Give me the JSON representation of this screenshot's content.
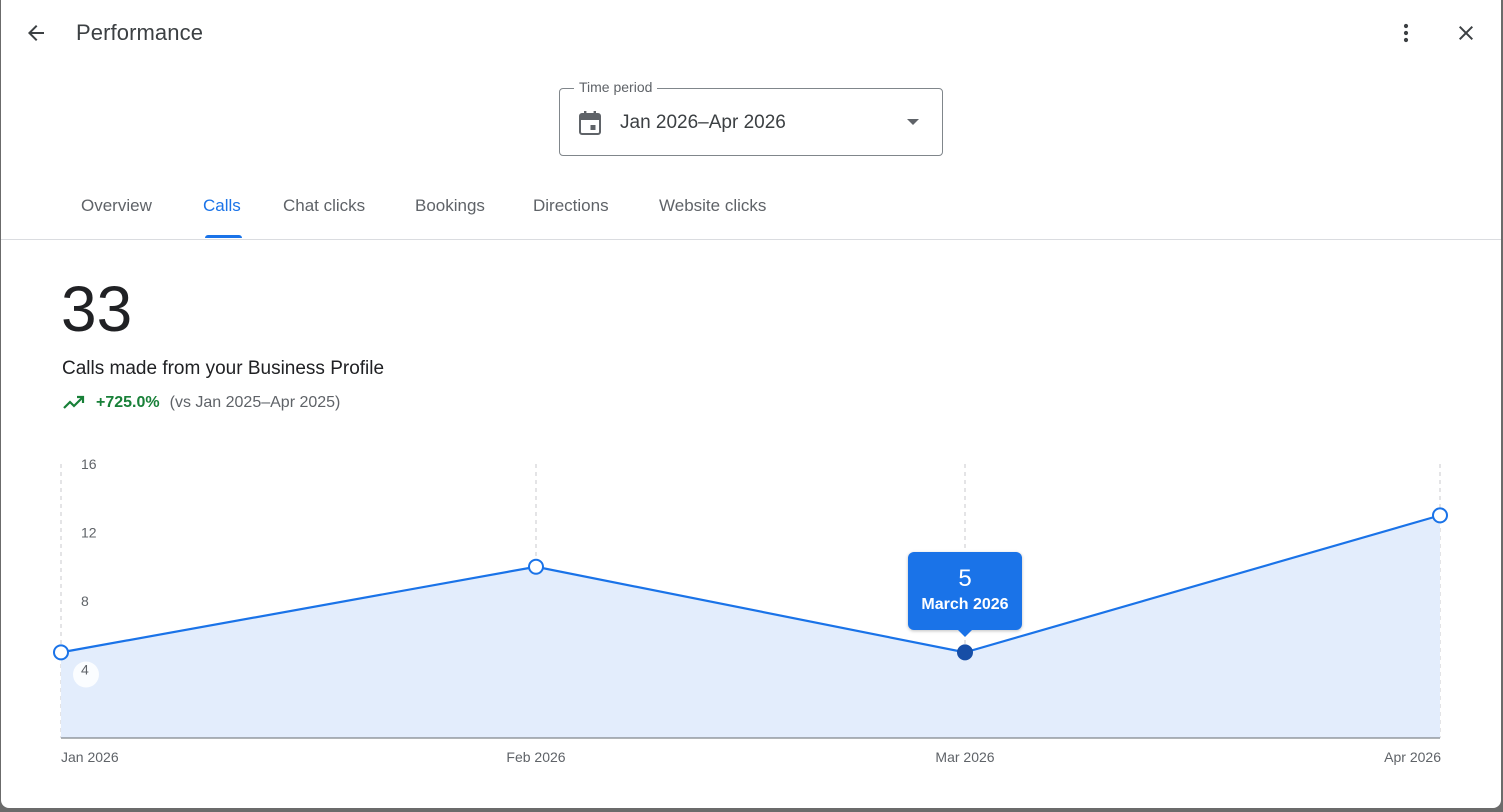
{
  "header": {
    "title": "Performance",
    "back_icon": "arrow-back-icon",
    "more_icon": "more-vert-icon",
    "close_icon": "close-icon"
  },
  "time_period": {
    "label": "Time period",
    "value": "Jan 2026–Apr 2026",
    "icon": "calendar-icon"
  },
  "tabs": [
    {
      "label": "Overview",
      "active": false
    },
    {
      "label": "Calls",
      "active": true
    },
    {
      "label": "Chat clicks",
      "active": false
    },
    {
      "label": "Bookings",
      "active": false
    },
    {
      "label": "Directions",
      "active": false
    },
    {
      "label": "Website clicks",
      "active": false
    }
  ],
  "metric": {
    "value": "33",
    "description": "Calls made from your Business Profile",
    "change": "+725.0%",
    "comparison": "(vs Jan 2025–Apr 2025)"
  },
  "colors": {
    "accent": "#1a73e8",
    "positive": "#188038",
    "area_fill": "#e3edfc",
    "line": "#1a73e8",
    "selected_point": "#174ea6"
  },
  "tooltip": {
    "value": "5",
    "label": "March 2026"
  },
  "chart_data": {
    "type": "area",
    "categories": [
      "Jan 2026",
      "Feb 2026",
      "Mar 2026",
      "Apr 2026"
    ],
    "series": [
      {
        "values": [
          5,
          10,
          5,
          13
        ]
      }
    ],
    "y_ticks": [
      "16",
      "12",
      "8",
      "4"
    ],
    "ylim": [
      0,
      16
    ],
    "selected_index": 2,
    "grid": "vertical-dashed",
    "legend": "none"
  }
}
